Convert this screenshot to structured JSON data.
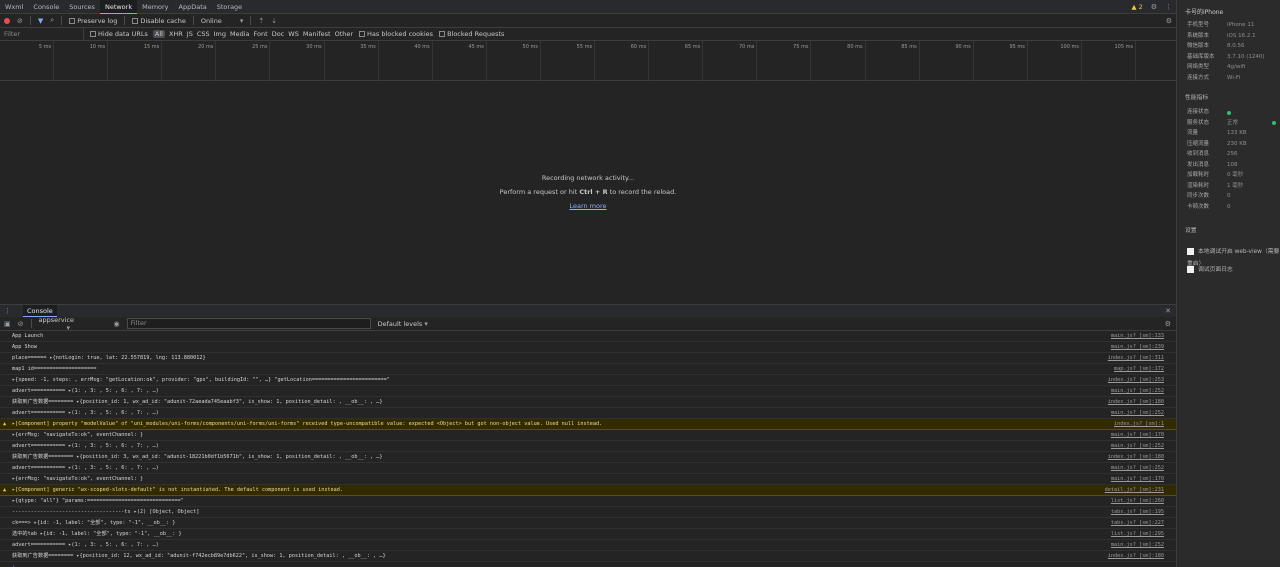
{
  "tabs": [
    "Wxml",
    "Console",
    "Sources",
    "Network",
    "Memory",
    "AppData",
    "Storage"
  ],
  "active_tab": "Network",
  "warning_count": "2",
  "toolbar": {
    "preserve_log": "Preserve log",
    "disable_cache": "Disable cache",
    "throttle": "Online"
  },
  "filter": {
    "placeholder": "Filter",
    "hide_data_urls": "Hide data URLs",
    "types": [
      "All",
      "XHR",
      "JS",
      "CSS",
      "Img",
      "Media",
      "Font",
      "Doc",
      "WS",
      "Manifest",
      "Other"
    ],
    "has_blocked_cookies": "Has blocked cookies",
    "blocked_requests": "Blocked Requests"
  },
  "timeline_ticks": [
    "5 ms",
    "10 ms",
    "15 ms",
    "20 ms",
    "25 ms",
    "30 ms",
    "35 ms",
    "40 ms",
    "45 ms",
    "50 ms",
    "55 ms",
    "60 ms",
    "65 ms",
    "70 ms",
    "75 ms",
    "80 ms",
    "85 ms",
    "90 ms",
    "95 ms",
    "100 ms",
    "105 ms"
  ],
  "empty_state": {
    "line1": "Recording network activity...",
    "line2_pre": "Perform a request or hit ",
    "line2_key": "Ctrl + R",
    "line2_post": " to record the reload.",
    "learn_more": "Learn more"
  },
  "drawer": {
    "tab": "Console",
    "context": "appservice",
    "filter_placeholder": "Filter",
    "levels": "Default levels"
  },
  "logs": [
    {
      "text": "App Launch",
      "src": "main.js? [sm]:133",
      "warn": false
    },
    {
      "text": "App Show",
      "src": "main.js? [sm]:239",
      "warn": false
    },
    {
      "text": "place====== ▸{notLogin: true, lat: 22.557819, lng: 113.880012}",
      "src": "index.js? [sm]:311",
      "warn": false
    },
    {
      "text": "map1 id====================",
      "src": "map.js? [sm]:172",
      "warn": false
    },
    {
      "text": "▸{speed: -1, steps: , errMsg: \"getLocation:ok\", provider: \"gps\", buildingId: \"\", …} \"getLocation========================\"",
      "src": "index.js? [sm]:253",
      "warn": false
    },
    {
      "text": "advert=========== ▸(1: , 3: , 5: , 6: , 7: , …)",
      "src": "main.js? [sm]:252",
      "warn": false
    },
    {
      "text": "获取到广告数据======== ▸{position_id: 1, wx_ad_id: \"adunit-72aeada745eaabf3\", is_show: 1, position_detail: , __ob__: , …}",
      "src": "index.js? [sm]:180",
      "warn": false
    },
    {
      "text": "advert=========== ▸(1: , 3: , 5: , 6: , 7: , …)",
      "src": "main.js? [sm]:252",
      "warn": false
    },
    {
      "text": "▸[Component] property \"modelValue\" of \"uni_modules/uni-forms/components/uni-forms/uni-forms\" received type-uncompatible value: expected <Object> but got non-object value. Used null instead.",
      "src": "index.js? [sm]:1",
      "warn": true
    },
    {
      "text": "▸{errMsg: \"navigateTo:ok\", eventChannel: }",
      "src": "main.js? [sm]:170",
      "warn": false
    },
    {
      "text": "advert=========== ▸(1: , 3: , 5: , 6: , 7: , …)",
      "src": "main.js? [sm]:252",
      "warn": false
    },
    {
      "text": "获取到广告数据======== ▸{position_id: 3, wx_ad_id: \"adunit-18221b0df1b5671b\", is_show: 1, position_detail: , __ob__: , …}",
      "src": "index.js? [sm]:180",
      "warn": false
    },
    {
      "text": "advert=========== ▸(1: , 3: , 5: , 6: , 7: , …)",
      "src": "main.js? [sm]:252",
      "warn": false
    },
    {
      "text": "▸{errMsg: \"navigateTo:ok\", eventChannel: }",
      "src": "main.js? [sm]:170",
      "warn": false
    },
    {
      "text": "▸[Component] generic \"wx-scoped-slots-default\" is not instantiated. The default component is used instead.",
      "src": "detail.js? [sm]:231",
      "warn": true
    },
    {
      "text": "▸{qtype: \"all\"} \"params:==============================\"",
      "src": "list.js? [sm]:260",
      "warn": false
    },
    {
      "text": "------------------------------------ts ▸(2) [Object, Object]",
      "src": "tabs.js? [sm]:195",
      "warn": false
    },
    {
      "text": "ck===> ▸{id: -1, label: \"全部\", type: \"-1\", __ob__: }",
      "src": "tabs.js? [sm]:227",
      "warn": false
    },
    {
      "text": "选中的tab ▸{id: -1, label: \"全部\", type: \"-1\", __ob__: }",
      "src": "list.js? [sm]:295",
      "warn": false
    },
    {
      "text": "advert=========== ▸(1: , 3: , 5: , 6: , 7: , …)",
      "src": "main.js? [sm]:252",
      "warn": false
    },
    {
      "text": "获取到广告数据======== ▸{position_id: 12, wx_ad_id: \"adunit-f742ecb89e7db622\", is_show: 1, position_detail: , __ob__: , …}",
      "src": "index.js? [sm]:180",
      "warn": false
    }
  ],
  "side_panel": {
    "title": "卡号的iPhone",
    "device_info": [
      {
        "k": "手机型号",
        "v": "iPhone 11"
      },
      {
        "k": "系统版本",
        "v": "iOS 16.2.1"
      },
      {
        "k": "微信版本",
        "v": "8.0.56"
      },
      {
        "k": "基础库版本",
        "v": "3.7.10 (1240)"
      },
      {
        "k": "网络类型",
        "v": "4g/wifi"
      },
      {
        "k": "连接方式",
        "v": "Wi-Fi"
      }
    ],
    "perf_title": "性能指标",
    "perf": [
      {
        "k": "连接状态",
        "v": ""
      },
      {
        "k": "服务状态",
        "v": "正常"
      },
      {
        "k": "流量",
        "v": "133 KB"
      },
      {
        "k": "压缩流量",
        "v": "230 KB"
      },
      {
        "k": "收到消息",
        "v": "256"
      },
      {
        "k": "发出消息",
        "v": "108"
      },
      {
        "k": "加载耗时",
        "v": "0 毫秒"
      },
      {
        "k": "渲染耗时",
        "v": "1 毫秒"
      },
      {
        "k": "同步次数",
        "v": "0"
      },
      {
        "k": "卡顿次数",
        "v": "0"
      }
    ],
    "settings_title": "设置",
    "settings": [
      "本地调试开启 web-view（需要重启）",
      "调试页面日志"
    ],
    "status_color": "#2fbf71"
  }
}
